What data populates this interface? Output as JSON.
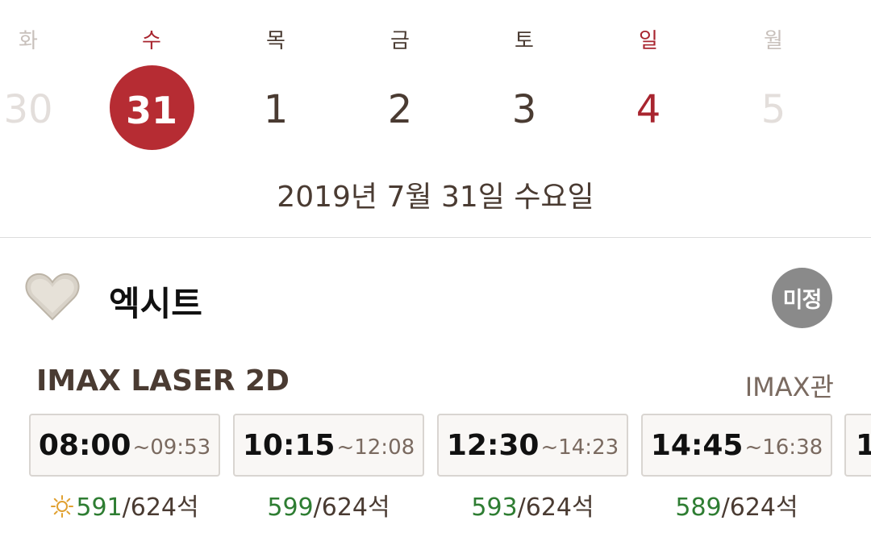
{
  "calendar": {
    "days": [
      {
        "dow": "화",
        "num": "30"
      },
      {
        "dow": "수",
        "num": "31"
      },
      {
        "dow": "목",
        "num": "1"
      },
      {
        "dow": "금",
        "num": "2"
      },
      {
        "dow": "토",
        "num": "3"
      },
      {
        "dow": "일",
        "num": "4"
      },
      {
        "dow": "월",
        "num": "5"
      }
    ],
    "full_date": "2019년 7월 31일 수요일"
  },
  "colors": {
    "accent": "#b62c33",
    "sunday": "#a8252f",
    "available": "#2e7d32",
    "rating": "#8a8a8a"
  },
  "movie": {
    "title": "엑시트",
    "rating_badge": "미정",
    "favorite_icon": "heart-icon"
  },
  "screening": {
    "format": "IMAX LASER 2D",
    "hall": "IMAX관",
    "sessions": [
      {
        "start": "08:00",
        "end": "~09:53",
        "available": "591",
        "total": "/624석",
        "icon": "sun-icon"
      },
      {
        "start": "10:15",
        "end": "~12:08",
        "available": "599",
        "total": "/624석"
      },
      {
        "start": "12:30",
        "end": "~14:23",
        "available": "593",
        "total": "/624석"
      },
      {
        "start": "14:45",
        "end": "~16:38",
        "available": "589",
        "total": "/624석"
      }
    ],
    "partial_session_start": "1"
  }
}
